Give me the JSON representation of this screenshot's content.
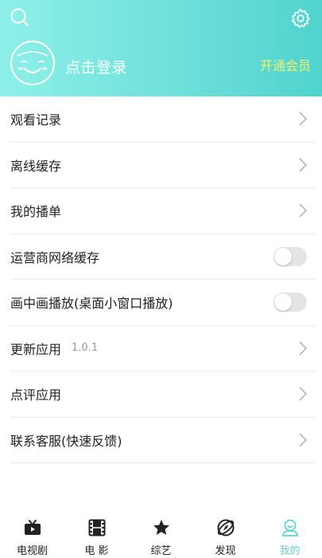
{
  "header": {
    "login_text": "点击登录",
    "vip_text": "开通会员"
  },
  "menu": [
    {
      "label": "观看记录",
      "control": "chevron"
    },
    {
      "label": "离线缓存",
      "control": "chevron"
    },
    {
      "label": "我的播单",
      "control": "chevron"
    },
    {
      "label": "运营商网络缓存",
      "control": "toggle",
      "on": false
    },
    {
      "label": "画中画播放(桌面小窗口播放)",
      "control": "toggle",
      "on": false
    },
    {
      "label": "更新应用",
      "sub": "1.0.1",
      "control": "chevron"
    },
    {
      "label": "点评应用",
      "control": "chevron"
    },
    {
      "label": "联系客服(快速反馈)",
      "control": "chevron"
    }
  ],
  "tabs": [
    {
      "label": "电视剧",
      "icon": "tv-icon"
    },
    {
      "label": "电 影",
      "icon": "film-icon"
    },
    {
      "label": "综艺",
      "icon": "star-icon"
    },
    {
      "label": "发现",
      "icon": "discover-icon"
    },
    {
      "label": "我的",
      "icon": "profile-icon",
      "active": true
    }
  ],
  "colors": {
    "accent": "#5cd6cf",
    "vip": "#f3f36a",
    "header_start": "#8ef0e8",
    "header_end": "#4fd3cf"
  }
}
